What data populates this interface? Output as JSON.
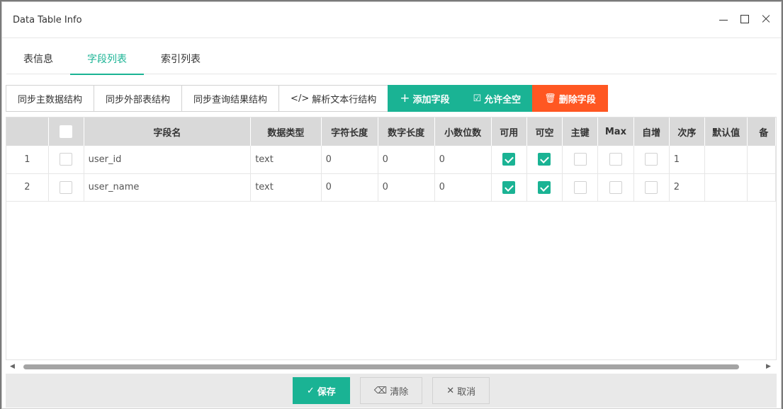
{
  "window": {
    "title": "Data Table Info"
  },
  "tabs": [
    {
      "label": "表信息",
      "active": false
    },
    {
      "label": "字段列表",
      "active": true
    },
    {
      "label": "索引列表",
      "active": false
    }
  ],
  "toolbar": {
    "sync_master": "同步主数据结构",
    "sync_external": "同步外部表结构",
    "sync_query": "同步查询结果结构",
    "parse_text": "解析文本行结构",
    "add_field": "添加字段",
    "allow_all_null": "允许全空",
    "delete_field": "删除字段"
  },
  "table": {
    "headers": {
      "field_name": "字段名",
      "data_type": "数据类型",
      "char_length": "字符长度",
      "num_length": "数字长度",
      "decimals": "小数位数",
      "enabled": "可用",
      "nullable": "可空",
      "primary_key": "主键",
      "max": "Max",
      "auto_inc": "自增",
      "order": "次序",
      "default": "默认值",
      "remark": "备"
    },
    "rows": [
      {
        "index": "1",
        "field_name": "user_id",
        "data_type": "text",
        "char_length": "0",
        "num_length": "0",
        "decimals": "0",
        "enabled": true,
        "nullable": true,
        "primary_key": false,
        "max": false,
        "auto_inc": false,
        "order": "1",
        "default": ""
      },
      {
        "index": "2",
        "field_name": "user_name",
        "data_type": "text",
        "char_length": "0",
        "num_length": "0",
        "decimals": "0",
        "enabled": true,
        "nullable": true,
        "primary_key": false,
        "max": false,
        "auto_inc": false,
        "order": "2",
        "default": ""
      }
    ]
  },
  "footer": {
    "save": "保存",
    "clear": "清除",
    "cancel": "取消"
  },
  "colors": {
    "accent": "#1ab394",
    "danger": "#ff5722"
  }
}
